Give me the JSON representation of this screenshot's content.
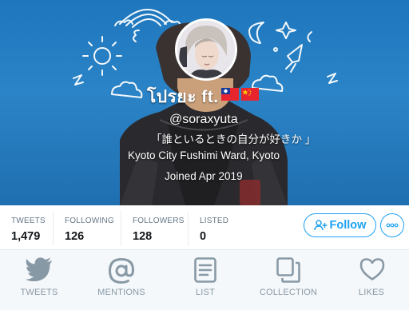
{
  "profile": {
    "display_name": "โปรยะ ft.",
    "handle": "@soraxyuta",
    "bio": "「誰といるときの自分が好きか 」",
    "location": "Kyoto City Fushimi Ward, Kyoto",
    "joined": "Joined Apr 2019"
  },
  "stats": {
    "tweets": {
      "label": "TWEETS",
      "value": "1,479"
    },
    "following": {
      "label": "FOLLOWING",
      "value": "126"
    },
    "followers": {
      "label": "FOLLOWERS",
      "value": "128"
    },
    "listed": {
      "label": "LISTED",
      "value": "0"
    }
  },
  "actions": {
    "follow_label": "Follow"
  },
  "tabs": [
    {
      "label": "TWEETS",
      "icon": "bird-icon"
    },
    {
      "label": "MENTIONS",
      "icon": "at-sign-icon"
    },
    {
      "label": "LIST",
      "icon": "list-icon"
    },
    {
      "label": "COLLECTION",
      "icon": "collection-icon"
    },
    {
      "label": "LIKES",
      "icon": "heart-icon"
    }
  ],
  "colors": {
    "banner": "#2b84c7",
    "accent": "#1da1f2",
    "tab_icon": "#8899a6"
  }
}
